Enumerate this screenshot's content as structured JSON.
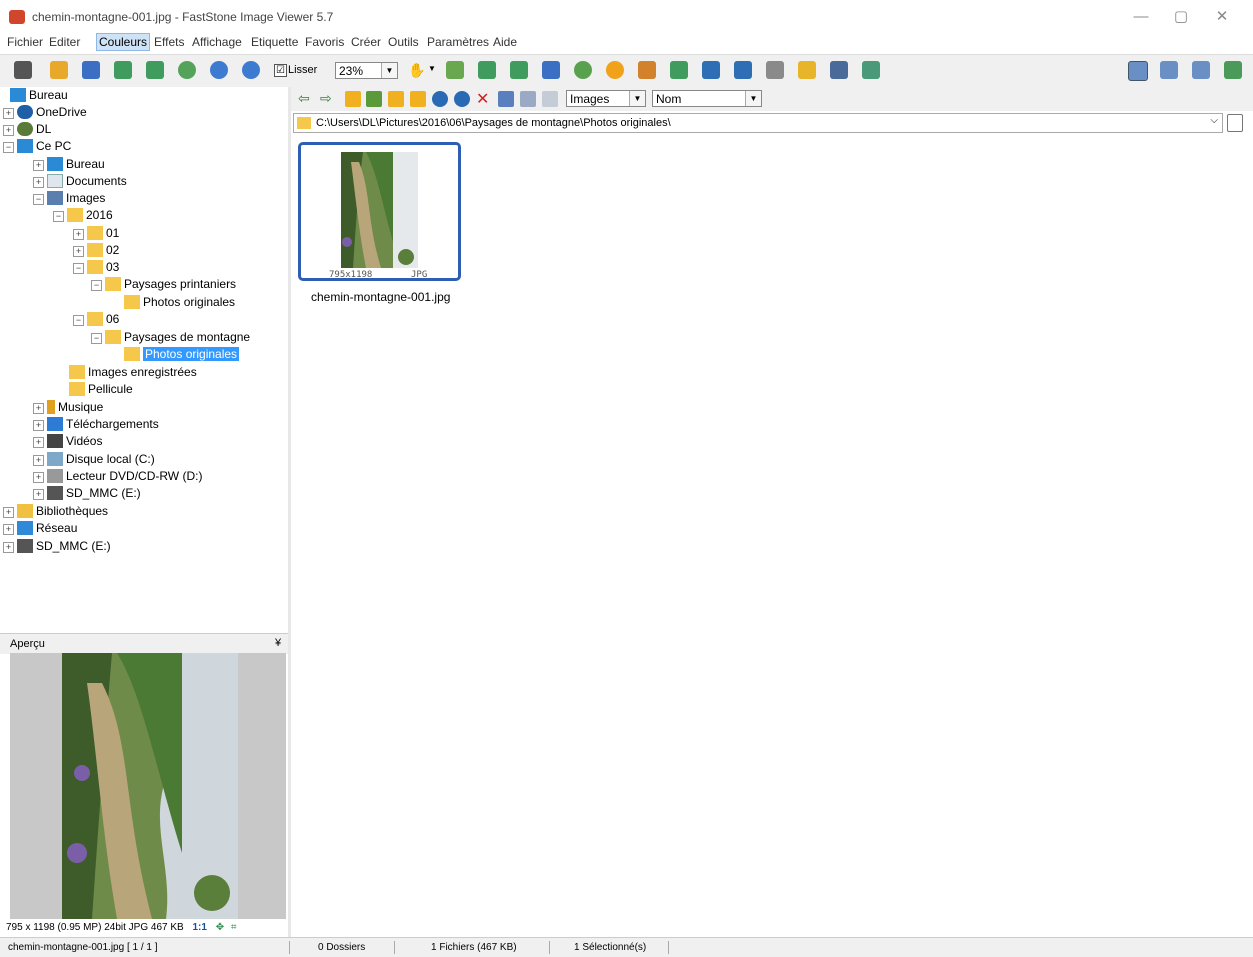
{
  "window": {
    "title": "chemin-montagne-001.jpg  -  FastStone Image Viewer 5.7",
    "controls": {
      "minimize": "—",
      "maximize": "▢",
      "close": "✕"
    }
  },
  "menu": {
    "items": [
      "Fichier",
      "Editer",
      "Couleurs",
      "Effets",
      "Affichage",
      "Etiquette",
      "Favoris",
      "Créer",
      "Outils",
      "Paramètres",
      "Aide"
    ],
    "active": "Couleurs"
  },
  "toolbar": {
    "smooth_label": "Lisser",
    "smooth_checked": "☑",
    "zoom_value": "23%",
    "hand_glyph": "✋",
    "icons": [
      "open-folder-icon",
      "browse-icon",
      "save-icon",
      "save-as-icon",
      "export-icon",
      "zoom-in-icon",
      "zoom-out-icon",
      "actual-size-icon"
    ],
    "tool_icons": [
      "slideshow-icon",
      "resize-icon",
      "crop-icon",
      "text-icon",
      "contact-icon",
      "effects-icon",
      "rotate-left-icon",
      "rotate-right-icon",
      "compare-icon",
      "copy-to-icon",
      "draw-icon",
      "email-icon",
      "print-icon",
      "scan-icon"
    ],
    "layout_icons": [
      "layout-1-icon",
      "layout-2-icon",
      "layout-3-icon",
      "fullscreen-icon"
    ]
  },
  "tree": {
    "items": [
      {
        "label": "Bureau",
        "icon": "desktop-icon"
      },
      {
        "label": "OneDrive",
        "icon": "onedrive-icon",
        "exp": "+"
      },
      {
        "label": "DL",
        "icon": "user-icon",
        "exp": "+"
      },
      {
        "label": "Ce PC",
        "icon": "computer-icon",
        "exp": "−"
      },
      {
        "label": "Bureau",
        "icon": "desktop-icon",
        "exp": "+"
      },
      {
        "label": "Documents",
        "icon": "documents-icon",
        "exp": "+"
      },
      {
        "label": "Images",
        "icon": "images-icon",
        "exp": "−"
      },
      {
        "label": "2016",
        "icon": "folder-icon",
        "exp": "−"
      },
      {
        "label": "01",
        "icon": "folder-icon",
        "exp": "+"
      },
      {
        "label": "02",
        "icon": "folder-icon",
        "exp": "+"
      },
      {
        "label": "03",
        "icon": "folder-icon",
        "exp": "−"
      },
      {
        "label": "Paysages printaniers",
        "icon": "folder-icon",
        "exp": "−"
      },
      {
        "label": "Photos originales",
        "icon": "folder-icon"
      },
      {
        "label": "06",
        "icon": "folder-icon",
        "exp": "−"
      },
      {
        "label": "Paysages de montagne",
        "icon": "folder-icon",
        "exp": "−"
      },
      {
        "label": "Photos originales",
        "icon": "folder-icon",
        "selected": true
      },
      {
        "label": "Images enregistrées",
        "icon": "folder-icon"
      },
      {
        "label": "Pellicule",
        "icon": "folder-icon"
      },
      {
        "label": "Musique",
        "icon": "music-icon",
        "exp": "+"
      },
      {
        "label": "Téléchargements",
        "icon": "downloads-icon",
        "exp": "+"
      },
      {
        "label": "Vidéos",
        "icon": "videos-icon",
        "exp": "+"
      },
      {
        "label": "Disque local (C:)",
        "icon": "drive-icon",
        "exp": "+"
      },
      {
        "label": "Lecteur DVD/CD-RW (D:)",
        "icon": "dvd-icon",
        "exp": "+"
      },
      {
        "label": "SD_MMC (E:)",
        "icon": "sd-card-icon",
        "exp": "+"
      },
      {
        "label": "Bibliothèques",
        "icon": "libraries-icon",
        "exp": "+"
      },
      {
        "label": "Réseau",
        "icon": "network-icon",
        "exp": "+"
      },
      {
        "label": "SD_MMC (E:)",
        "icon": "sd-card-icon",
        "exp": "+"
      }
    ]
  },
  "preview": {
    "title": "Aperçu",
    "collapse_glyph": "¥",
    "info": "795 x 1198 (0.95 MP)  24bit  JPG  467 KB",
    "ratio": "1:1"
  },
  "browser": {
    "filter": "Images",
    "sort": "Nom",
    "path": "C:\\Users\\DL\\Pictures\\2016\\06\\Paysages de montagne\\Photos originales\\",
    "thumbnail": {
      "dimensions": "795x1198",
      "format": "JPG",
      "filename": "chemin-montagne-001.jpg"
    }
  },
  "status": {
    "file": "chemin-montagne-001.jpg [ 1 / 1 ]",
    "folders": "0 Dossiers",
    "files": "1 Fichiers (467 KB)",
    "selected": "1 Sélectionné(s)"
  },
  "colors": {
    "selection": "#3399ff",
    "thumb_border": "#2e5eb4",
    "folder": "#f5c84c"
  }
}
